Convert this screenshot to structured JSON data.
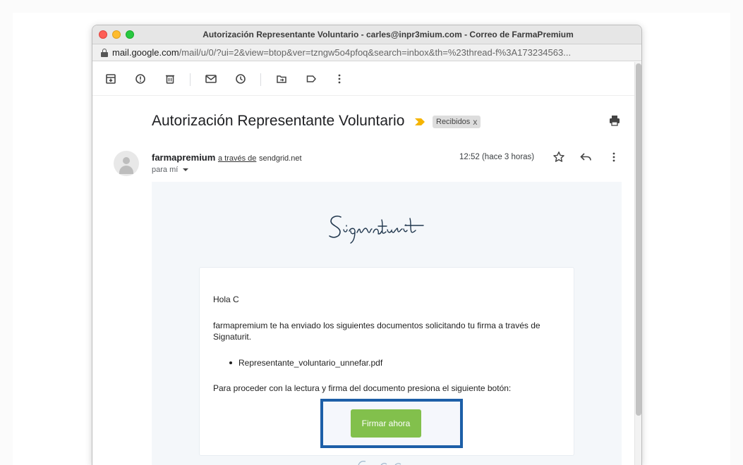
{
  "window": {
    "title": "Autorización Representante Voluntario - carles@inpr3mium.com - Correo de FarmaPremium",
    "url_host": "mail.google.com",
    "url_path": "/mail/u/0/?ui=2&view=btop&ver=tzngw5o4pfoq&search=inbox&th=%23thread-f%3A173234563..."
  },
  "toolbar": {
    "icons": [
      "archive-icon",
      "report-spam-icon",
      "delete-icon",
      "mark-unread-icon",
      "snooze-icon",
      "move-to-icon",
      "label-icon",
      "more-vert-icon"
    ]
  },
  "email": {
    "subject": "Autorización Representante Voluntario",
    "label": "Recibidos",
    "label_close": "x",
    "sender": "farmapremium",
    "via_text": "a través de",
    "via_domain": "sendgrid.net",
    "time": "12:52 (hace 3 horas)",
    "to": "para mí"
  },
  "body": {
    "logo_text": "Signaturit",
    "greeting": "Hola C",
    "paragraph1": "farmapremium te ha enviado los siguientes documentos solicitando tu firma a través de Signaturit.",
    "document": "Representante_voluntario_unnefar.pdf",
    "paragraph2": "Para proceder con la lectura y firma del documento presiona el siguiente botón:",
    "button_label": "Firmar ahora"
  },
  "colors": {
    "accent_button": "#82c04c",
    "highlight_border": "#1d5fa8",
    "importance_marker": "#f5b400"
  }
}
